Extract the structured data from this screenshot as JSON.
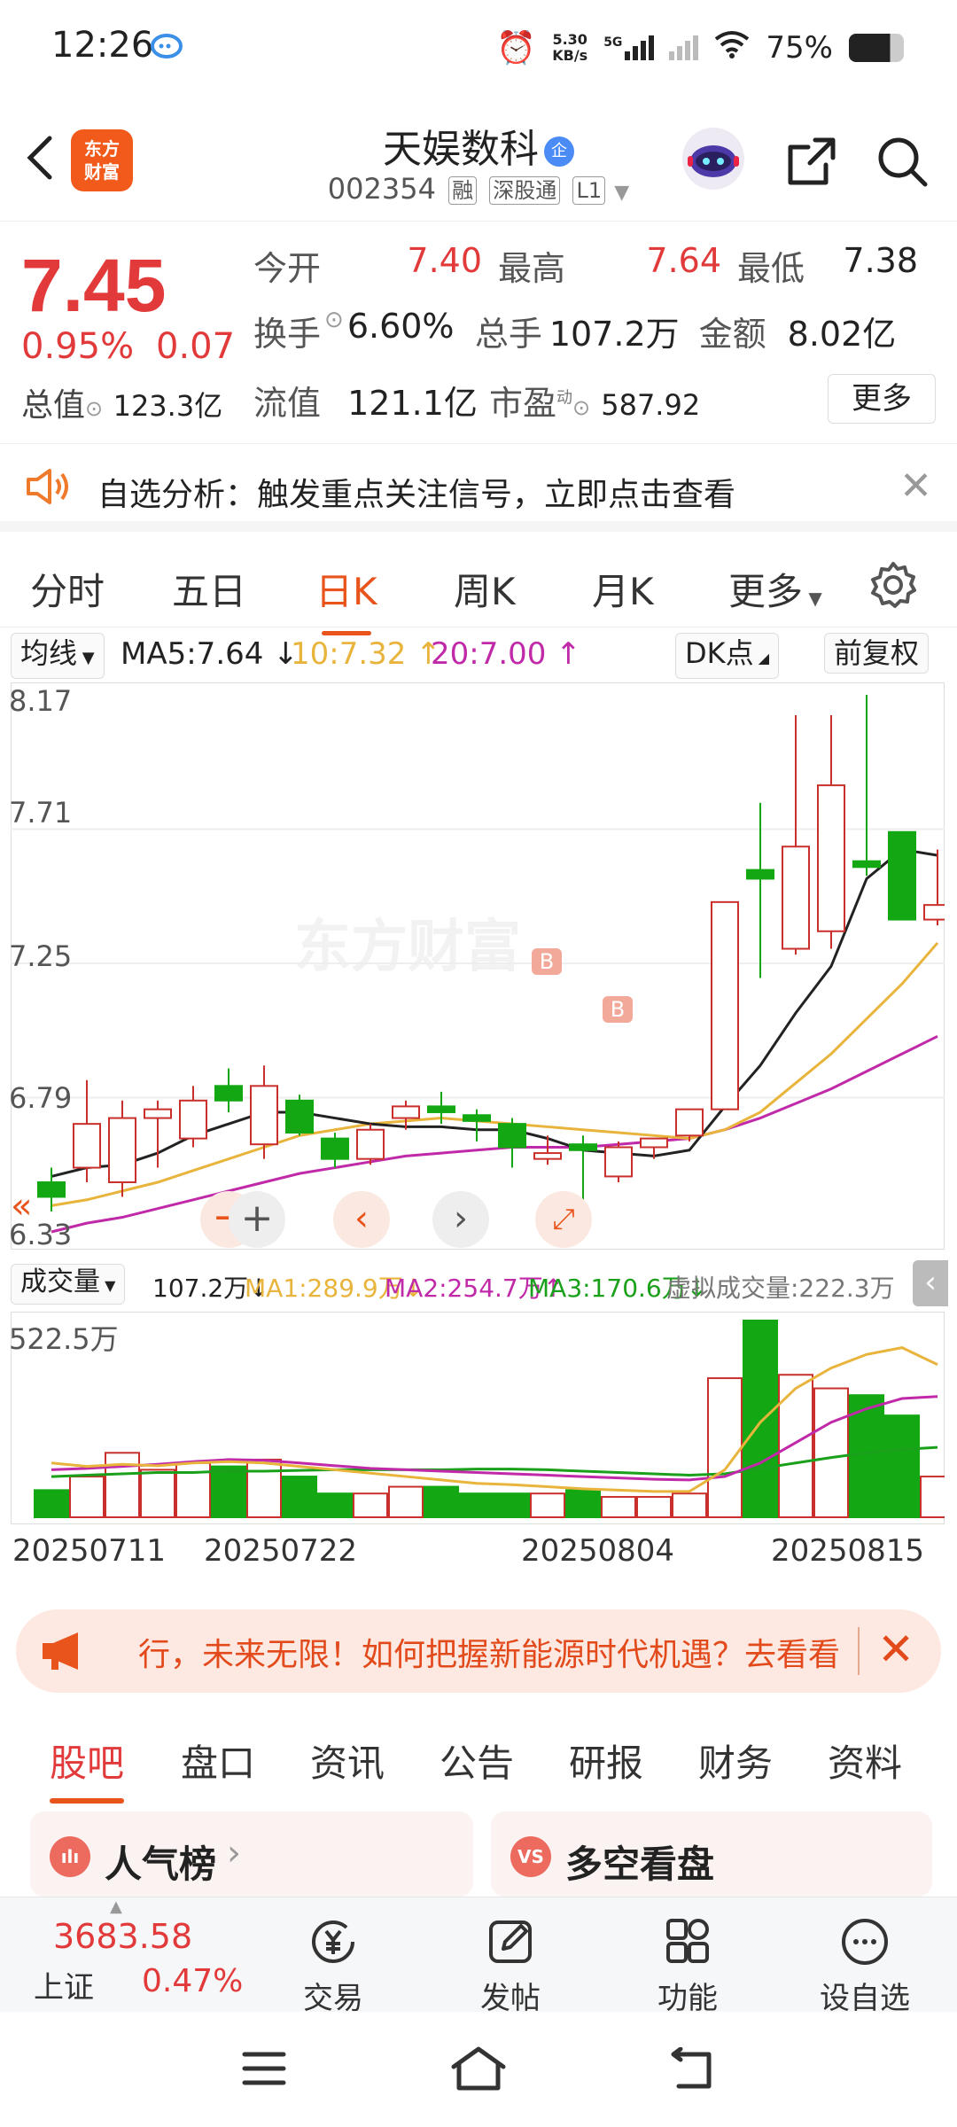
{
  "status": {
    "time": "12:26",
    "net_speed": "5.30",
    "net_unit": "KB/s",
    "network": "5G",
    "battery": "75%"
  },
  "header": {
    "title": "天娱数科",
    "badge": "企",
    "code": "002354",
    "tags": [
      "融",
      "深股通",
      "L1"
    ],
    "logo_line1": "东方",
    "logo_line2": "财富"
  },
  "quote": {
    "price": "7.45",
    "pct": "0.95%",
    "change": "0.07",
    "open_label": "今开",
    "open": "7.40",
    "high_label": "最高",
    "high": "7.64",
    "low_label": "最低",
    "low": "7.38",
    "turnover_label": "换手",
    "turnover": "6.60%",
    "volume_label": "总手",
    "volume": "107.2万",
    "amount_label": "金额",
    "amount": "8.02亿",
    "mktcap_label": "总值",
    "mktcap": "123.3亿",
    "float_label": "流值",
    "float": "121.1亿",
    "pe_label": "市盈",
    "pe_sup": "动",
    "pe": "587.92",
    "more": "更多"
  },
  "notice": {
    "text": "自选分析：触发重点关注信号，立即点击查看"
  },
  "period_tabs": [
    "分时",
    "五日",
    "日K",
    "周K",
    "月K",
    "更多"
  ],
  "ma": {
    "selector": "均线",
    "ma5": "MA5:7.64 ↓",
    "ma10": "10:7.32 ↑",
    "ma20": "20:7.00 ↑",
    "dk": "DK点",
    "fq": "前复权"
  },
  "volume_bar": {
    "selector": "成交量",
    "vol": "107.2万↓",
    "ma1": "MA1:289.9万↓",
    "ma2": "MA2:254.7万↑",
    "ma3": "MA3:170.6万↓",
    "virtual": "虚拟成交量:222.3万",
    "max": "522.5万"
  },
  "watermark": "东方财富",
  "dates": [
    "20250711",
    "20250722",
    "20250804",
    "20250815"
  ],
  "banner": {
    "text": "行，未来无限！如何把握新能源时代机遇？去看看"
  },
  "content_tabs": [
    "股吧",
    "盘口",
    "资讯",
    "公告",
    "研报",
    "财务",
    "资料"
  ],
  "cards": [
    {
      "label": "人气榜",
      "icon": "ılı"
    },
    {
      "label": "多空看盘",
      "icon": "VS"
    }
  ],
  "bottom_nav": {
    "index_value": "3683.58",
    "index_name": "上证",
    "index_pct": "0.47%",
    "items": [
      "交易",
      "发帖",
      "功能",
      "设自选"
    ]
  },
  "chart_data": {
    "type": "candlestick",
    "y_ticks": [
      "8.17",
      "7.71",
      "7.25",
      "6.79",
      "6.33"
    ],
    "ylim": [
      6.33,
      8.17
    ],
    "buy_markers": [
      "B",
      "B"
    ],
    "candles": [
      {
        "o": 6.5,
        "h": 6.55,
        "l": 6.4,
        "c": 6.45
      },
      {
        "o": 6.55,
        "h": 6.85,
        "l": 6.5,
        "c": 6.7
      },
      {
        "o": 6.5,
        "h": 6.78,
        "l": 6.45,
        "c": 6.72
      },
      {
        "o": 6.72,
        "h": 6.78,
        "l": 6.55,
        "c": 6.75
      },
      {
        "o": 6.65,
        "h": 6.83,
        "l": 6.62,
        "c": 6.78
      },
      {
        "o": 6.83,
        "h": 6.89,
        "l": 6.74,
        "c": 6.78
      },
      {
        "o": 6.63,
        "h": 6.9,
        "l": 6.58,
        "c": 6.83
      },
      {
        "o": 6.78,
        "h": 6.8,
        "l": 6.66,
        "c": 6.67
      },
      {
        "o": 6.65,
        "h": 6.67,
        "l": 6.55,
        "c": 6.58
      },
      {
        "o": 6.58,
        "h": 6.7,
        "l": 6.56,
        "c": 6.68
      },
      {
        "o": 6.72,
        "h": 6.78,
        "l": 6.68,
        "c": 6.76
      },
      {
        "o": 6.76,
        "h": 6.81,
        "l": 6.7,
        "c": 6.74
      },
      {
        "o": 6.73,
        "h": 6.75,
        "l": 6.64,
        "c": 6.71
      },
      {
        "o": 6.7,
        "h": 6.72,
        "l": 6.55,
        "c": 6.62
      },
      {
        "o": 6.58,
        "h": 6.66,
        "l": 6.56,
        "c": 6.6
      },
      {
        "o": 6.63,
        "h": 6.66,
        "l": 6.4,
        "c": 6.61
      },
      {
        "o": 6.52,
        "h": 6.64,
        "l": 6.5,
        "c": 6.62
      },
      {
        "o": 6.62,
        "h": 6.64,
        "l": 6.58,
        "c": 6.65
      },
      {
        "o": 6.66,
        "h": 6.75,
        "l": 6.64,
        "c": 6.75
      },
      {
        "o": 6.75,
        "h": 7.46,
        "l": 6.75,
        "c": 7.46
      },
      {
        "o": 7.57,
        "h": 7.8,
        "l": 7.2,
        "c": 7.54
      },
      {
        "o": 7.3,
        "h": 8.1,
        "l": 7.28,
        "c": 7.65
      },
      {
        "o": 7.36,
        "h": 8.1,
        "l": 7.3,
        "c": 7.86
      },
      {
        "o": 7.6,
        "h": 8.17,
        "l": 7.55,
        "c": 7.58
      },
      {
        "o": 7.7,
        "h": 7.64,
        "l": 7.4,
        "c": 7.4
      },
      {
        "o": 7.4,
        "h": 7.64,
        "l": 7.38,
        "c": 7.45
      }
    ],
    "ma5": [
      6.52,
      6.55,
      6.56,
      6.6,
      6.66,
      6.7,
      6.74,
      6.74,
      6.72,
      6.7,
      6.69,
      6.69,
      6.68,
      6.68,
      6.65,
      6.61,
      6.6,
      6.59,
      6.61,
      6.76,
      6.9,
      7.08,
      7.24,
      7.54,
      7.64,
      7.62
    ],
    "ma10": [
      6.42,
      6.44,
      6.47,
      6.5,
      6.54,
      6.58,
      6.62,
      6.66,
      6.68,
      6.7,
      6.71,
      6.72,
      6.71,
      6.7,
      6.69,
      6.68,
      6.67,
      6.66,
      6.65,
      6.68,
      6.74,
      6.84,
      6.94,
      7.06,
      7.18,
      7.32
    ],
    "ma20": [
      6.33,
      6.36,
      6.38,
      6.41,
      6.44,
      6.47,
      6.5,
      6.53,
      6.55,
      6.57,
      6.59,
      6.6,
      6.61,
      6.62,
      6.62,
      6.62,
      6.63,
      6.64,
      6.65,
      6.68,
      6.72,
      6.77,
      6.82,
      6.88,
      6.94,
      7.0
    ],
    "volume": [
      40,
      60,
      95,
      70,
      80,
      75,
      85,
      60,
      35,
      35,
      45,
      45,
      35,
      35,
      35,
      40,
      30,
      30,
      35,
      205,
      290,
      210,
      190,
      180,
      150,
      60
    ],
    "vol_ma1": [
      80,
      75,
      78,
      76,
      80,
      82,
      80,
      75,
      70,
      65,
      60,
      55,
      50,
      48,
      45,
      42,
      40,
      38,
      38,
      70,
      140,
      190,
      220,
      240,
      250,
      225
    ],
    "vol_ma2": [
      70,
      72,
      75,
      78,
      82,
      85,
      84,
      80,
      76,
      72,
      70,
      68,
      66,
      64,
      62,
      60,
      58,
      56,
      55,
      60,
      80,
      110,
      140,
      160,
      175,
      178
    ],
    "vol_ma3": [
      60,
      62,
      64,
      66,
      66,
      68,
      68,
      69,
      70,
      70,
      70,
      70,
      71,
      71,
      70,
      68,
      66,
      64,
      62,
      64,
      72,
      80,
      88,
      95,
      100,
      103
    ]
  }
}
